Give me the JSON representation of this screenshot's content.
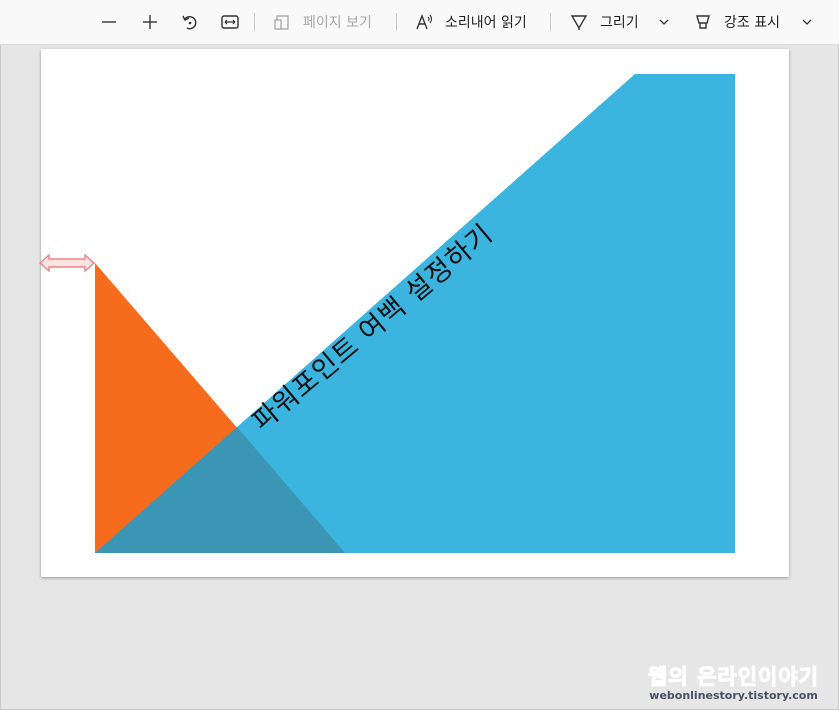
{
  "toolbar": {
    "zoom_out_icon": "minus-icon",
    "zoom_in_icon": "plus-icon",
    "rotate_icon": "rotate-icon",
    "fit_icon": "fit-width-icon",
    "page_view_label": "페이지 보기",
    "read_aloud_label": "소리내어 읽기",
    "draw_label": "그리기",
    "highlight_label": "강조 표시"
  },
  "slide": {
    "title": "파워포인트 여백 설정하기",
    "colors": {
      "blue": "#3cb4e0",
      "orange": "#f76b1c",
      "overlap": "#3b96b5",
      "arrow": "#e98686"
    }
  },
  "watermark": {
    "line1": "웹의 온라인이야기",
    "line2": "webonlinestory.tistory.com"
  }
}
